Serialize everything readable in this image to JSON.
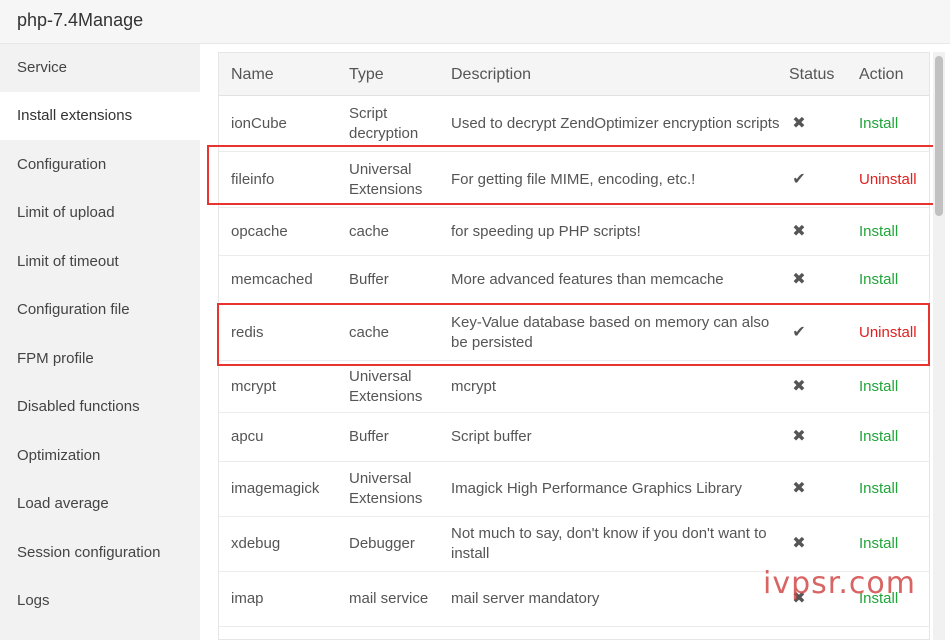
{
  "window": {
    "title": "php-7.4Manage"
  },
  "sidebar": {
    "items": [
      {
        "label": "Service",
        "active": false
      },
      {
        "label": "Install extensions",
        "active": true
      },
      {
        "label": "Configuration",
        "active": false
      },
      {
        "label": "Limit of upload",
        "active": false
      },
      {
        "label": "Limit of timeout",
        "active": false
      },
      {
        "label": "Configuration file",
        "active": false
      },
      {
        "label": "FPM profile",
        "active": false
      },
      {
        "label": "Disabled functions",
        "active": false
      },
      {
        "label": "Optimization",
        "active": false
      },
      {
        "label": "Load average",
        "active": false
      },
      {
        "label": "Session configuration",
        "active": false
      },
      {
        "label": "Logs",
        "active": false
      }
    ]
  },
  "table": {
    "headers": {
      "name": "Name",
      "type": "Type",
      "description": "Description",
      "status": "Status",
      "action": "Action"
    },
    "rows": [
      {
        "name": "ionCube",
        "type": "Script decryption",
        "description": "Used to decrypt ZendOptimizer encryption scripts",
        "status": "✖",
        "action": "Install",
        "installed": false
      },
      {
        "name": "fileinfo",
        "type": "Universal Extensions",
        "description": "For getting file MIME, encoding, etc.!",
        "status": "✔",
        "action": "Uninstall",
        "installed": true
      },
      {
        "name": "opcache",
        "type": "cache",
        "description": "for speeding up PHP scripts!",
        "status": "✖",
        "action": "Install",
        "installed": false
      },
      {
        "name": "memcached",
        "type": "Buffer",
        "description": "More advanced features than memcache",
        "status": "✖",
        "action": "Install",
        "installed": false
      },
      {
        "name": "redis",
        "type": "cache",
        "description": "Key-Value database based on memory can also be persisted",
        "status": "✔",
        "action": "Uninstall",
        "installed": true
      },
      {
        "name": "mcrypt",
        "type": "Universal Extensions",
        "description": "mcrypt",
        "status": "✖",
        "action": "Install",
        "installed": false
      },
      {
        "name": "apcu",
        "type": "Buffer",
        "description": "Script buffer",
        "status": "✖",
        "action": "Install",
        "installed": false
      },
      {
        "name": "imagemagick",
        "type": "Universal Extensions",
        "description": "Imagick High Performance Graphics Library",
        "status": "✖",
        "action": "Install",
        "installed": false
      },
      {
        "name": "xdebug",
        "type": "Debugger",
        "description": "Not much to say, don't know if you don't want to install",
        "status": "✖",
        "action": "Install",
        "installed": false
      },
      {
        "name": "imap",
        "type": "mail service",
        "description": "mail server mandatory",
        "status": "✖",
        "action": "Install",
        "installed": false
      }
    ]
  },
  "watermark": {
    "text": "ivpsr.com"
  },
  "colors": {
    "install": "#20a53a",
    "uninstall": "#e02020",
    "highlight": "#e8332f"
  }
}
